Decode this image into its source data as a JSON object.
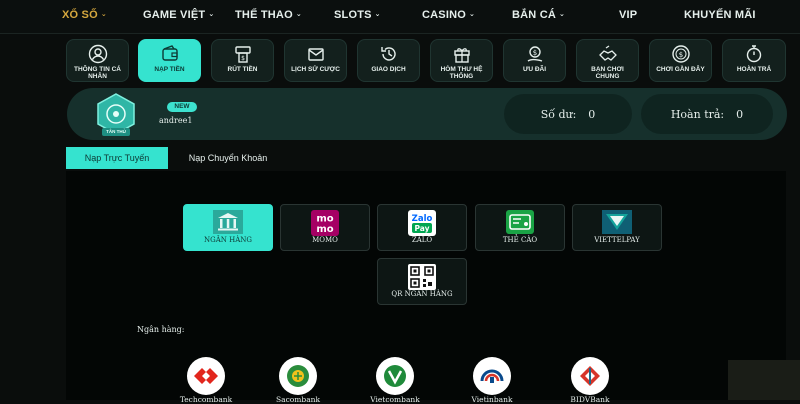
{
  "nav": {
    "items": [
      {
        "label": "XỔ SỐ",
        "caret": true,
        "active": true
      },
      {
        "label": "GAME VIỆT",
        "caret": true
      },
      {
        "label": "THỂ THAO",
        "caret": true
      },
      {
        "label": "SLOTS",
        "caret": true
      },
      {
        "label": "CASINO",
        "caret": true
      },
      {
        "label": "BẮN CÁ",
        "caret": true
      },
      {
        "label": "VIP",
        "caret": false
      },
      {
        "label": "KHUYẾN MÃI",
        "caret": false
      }
    ]
  },
  "menu": {
    "items": [
      {
        "label": "THÔNG TIN CÁ NHÂN",
        "icon": "user-icon"
      },
      {
        "label": "NẠP TIỀN",
        "icon": "wallet-icon",
        "active": true
      },
      {
        "label": "RÚT TIỀN",
        "icon": "atm-icon"
      },
      {
        "label": "LỊCH SỬ CƯỢC",
        "icon": "envelope-icon"
      },
      {
        "label": "GIAO DỊCH",
        "icon": "history-icon"
      },
      {
        "label": "HÒM THƯ HỆ THỐNG",
        "icon": "gift-icon"
      },
      {
        "label": "ƯU ĐÃI",
        "icon": "coin-hand-icon"
      },
      {
        "label": "BẠN CHƠI CHUNG",
        "icon": "handshake-icon"
      },
      {
        "label": "CHƠI GẦN ĐÂY",
        "icon": "dollar-circle-icon"
      },
      {
        "label": "HOÀN TRẢ",
        "icon": "stopwatch-icon"
      }
    ]
  },
  "profile": {
    "badge_text": "TÂN THỦ",
    "new_label": "NEW",
    "username": "andree1",
    "balance_label": "Số dư:",
    "balance_value": "0",
    "refund_label": "Hoàn trả:",
    "refund_value": "0"
  },
  "tabs": [
    {
      "label": "Nạp Trực Tuyến",
      "active": true
    },
    {
      "label": "Nạp Chuyển Khoản",
      "active": false
    }
  ],
  "methods": [
    {
      "label": "NGÂN HÀNG",
      "icon": "bank-icon",
      "active": true
    },
    {
      "label": "MOMO",
      "icon": "momo-icon"
    },
    {
      "label": "ZALO",
      "icon": "zalopay-icon"
    },
    {
      "label": "THẺ CÀO",
      "icon": "card-icon"
    },
    {
      "label": "VIETTELPAY",
      "icon": "viettelpay-icon"
    },
    {
      "label": "QR NGÂN HÀNG",
      "icon": "qr-icon"
    }
  ],
  "logo_text": {
    "momo_top": "mo",
    "momo_bottom": "mo",
    "zalo_top": "Zalo",
    "zalo_bottom": "Pay"
  },
  "bank_section": {
    "label": "Ngân hàng:",
    "banks": [
      {
        "name": "Techcombank",
        "color": "#e2261d"
      },
      {
        "name": "Sacombank",
        "color": "#2a8c3c"
      },
      {
        "name": "Vietcombank",
        "color": "#1f8a3a"
      },
      {
        "name": "Vietinbank",
        "color": "#0a4a8c"
      },
      {
        "name": "BIDVBank",
        "color": "#d6352a"
      }
    ]
  },
  "colors": {
    "accent": "#35e3cf",
    "nav_active": "#d6a83e",
    "background": "#0a0d0c"
  }
}
